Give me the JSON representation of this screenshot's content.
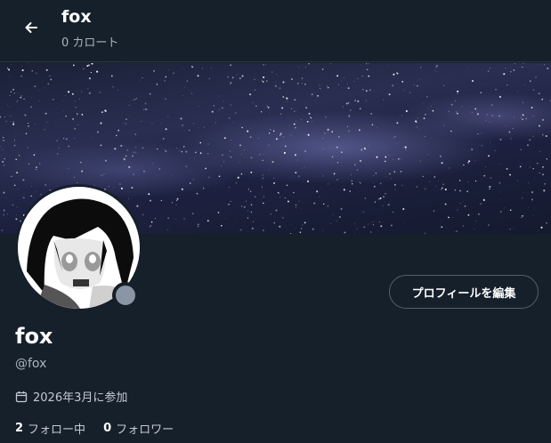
{
  "header": {
    "name": "fox",
    "subtitle": "0 カロート",
    "back_icon": "arrow-left-icon"
  },
  "banner": {
    "description_icon": "starry-night-banner"
  },
  "profile": {
    "name": "fox",
    "handle": "@fox",
    "joined": "2026年3月に参加",
    "edit_button": "プロフィールを編集",
    "following_count": "2",
    "following_label": "フォロー中",
    "followers_count": "0",
    "followers_label": "フォロワー"
  },
  "colors": {
    "background": "#16202b",
    "text_primary": "#ffffff",
    "text_secondary": "#aab4bf",
    "border": "#53606e",
    "status_dot": "#8a96a6"
  }
}
